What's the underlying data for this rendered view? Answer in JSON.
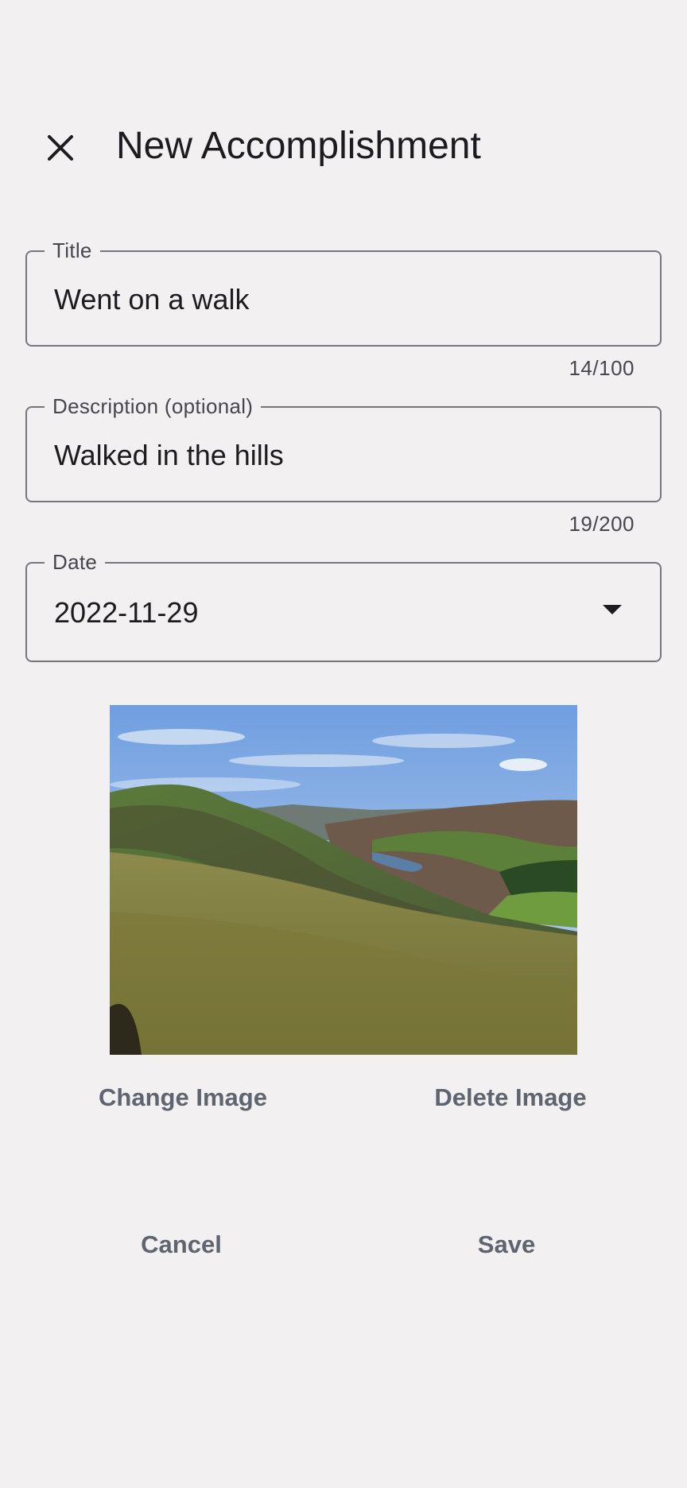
{
  "header": {
    "title": "New Accomplishment",
    "close_icon": "close-icon"
  },
  "form": {
    "title_field": {
      "label": "Title",
      "value": "Went on a walk",
      "counter": "14/100"
    },
    "description_field": {
      "label": "Description (optional)",
      "value": "Walked in the hills",
      "counter": "19/200"
    },
    "date_field": {
      "label": "Date",
      "value": "2022-11-29",
      "dropdown_icon": "arrow-drop-down-icon"
    }
  },
  "image_section": {
    "change_label": "Change Image",
    "delete_label": "Delete Image"
  },
  "actions": {
    "cancel_label": "Cancel",
    "save_label": "Save"
  },
  "colors": {
    "background": "#f3f0f1",
    "outline": "#79747e",
    "button_text": "#5e6470"
  }
}
